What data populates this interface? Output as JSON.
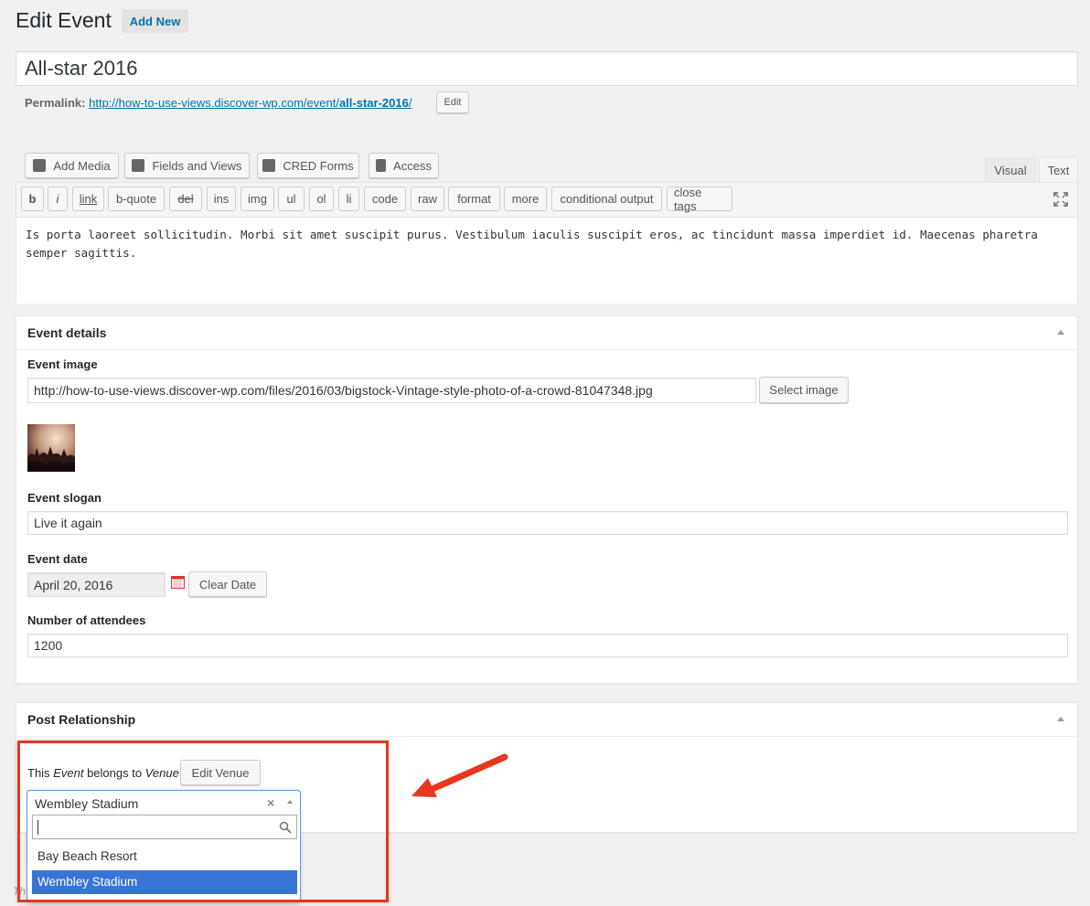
{
  "header": {
    "title": "Edit Event",
    "add_new": "Add New"
  },
  "post": {
    "title": "All-star 2016",
    "permalink_label": "Permalink:",
    "permalink_base": "http://how-to-use-views.discover-wp.com/event/",
    "permalink_slug": "all-star-2016",
    "permalink_trail": "/",
    "permalink_edit": "Edit"
  },
  "media_buttons": [
    {
      "label": "Add Media",
      "icon": "media-icon"
    },
    {
      "label": "Fields and Views",
      "icon": "fields-views-icon"
    },
    {
      "label": "CRED Forms",
      "icon": "cred-forms-icon"
    },
    {
      "label": "Access",
      "icon": "lock-icon"
    }
  ],
  "editor_tabs": {
    "visual": "Visual",
    "text": "Text"
  },
  "quicktags": [
    "b",
    "i",
    "link",
    "b-quote",
    "del",
    "ins",
    "img",
    "ul",
    "ol",
    "li",
    "code",
    "raw",
    "format",
    "more",
    "conditional output",
    "close tags"
  ],
  "editor": {
    "content": "Is porta laoreet sollicitudin. Morbi sit amet suscipit purus. Vestibulum iaculis suscipit eros, ac tincidunt massa imperdiet id. Maecenas pharetra semper sagittis."
  },
  "event_details": {
    "title": "Event details",
    "image_label": "Event image",
    "image_url": "http://how-to-use-views.discover-wp.com/files/2016/03/bigstock-Vintage-style-photo-of-a-crowd-81047348.jpg",
    "select_image": "Select image",
    "slogan_label": "Event slogan",
    "slogan": "Live it again",
    "date_label": "Event date",
    "date": "April 20, 2016",
    "clear_date": "Clear Date",
    "attendees_label": "Number of attendees",
    "attendees": "1200"
  },
  "relationship": {
    "title": "Post Relationship",
    "text_this": "This",
    "text_event": "Event",
    "text_belongs": "belongs to",
    "text_venue": "Venue",
    "edit_venue": "Edit Venue",
    "selected": "Wembley Stadium",
    "clear_symbol": "×",
    "search_value": "",
    "options": [
      "Bay Beach Resort",
      "Wembley Stadium"
    ],
    "highlighted_index": 1,
    "footer_fragment": "Th"
  },
  "colors": {
    "link": "#0073aa",
    "highlight": "#3875d7",
    "annotation": "#e6371f"
  }
}
